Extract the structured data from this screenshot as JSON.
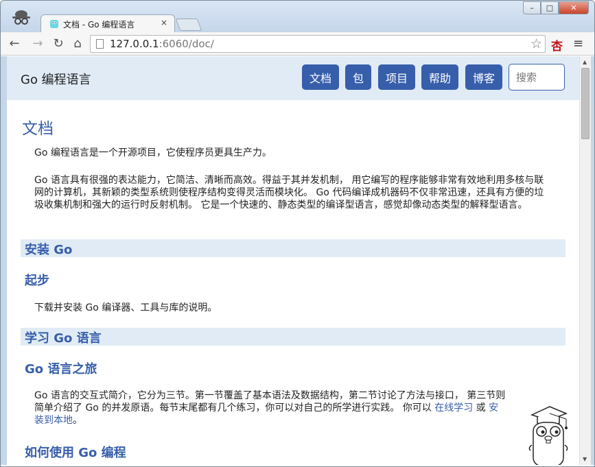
{
  "browser": {
    "tab_title": "文档 - Go 编程语言",
    "tab_close": "×",
    "url_host": "127.0.0.1",
    "url_rest": ":6060/doc/",
    "controls": {
      "min": "–",
      "max": "□",
      "close": "✕"
    },
    "nav": {
      "back": "←",
      "forward": "→",
      "reload": "↻",
      "home": "⌂"
    },
    "star": "☆",
    "ext_icon": "杏",
    "menu": "≡"
  },
  "site": {
    "title": "Go 编程语言",
    "nav": [
      {
        "label": "文档"
      },
      {
        "label": "包"
      },
      {
        "label": "项目"
      },
      {
        "label": "帮助"
      },
      {
        "label": "博客"
      }
    ],
    "search_placeholder": "搜索"
  },
  "page": {
    "heading": "文档",
    "intro1": "Go 编程语言是一个开源项目，它使程序员更具生产力。",
    "intro2": "Go 语言具有很强的表达能力，它简洁、清晰而高效。得益于其并发机制， 用它编写的程序能够非常有效地利用多核与联网的计算机，其新颖的类型系统则使程序结构变得灵活而模块化。 Go 代码编译成机器码不仅非常迅速，还具有方便的垃圾收集机制和强大的运行时反射机制。 它是一个快速的、静态类型的编译型语言，感觉却像动态类型的解释型语言。",
    "sections": {
      "install": {
        "title": "安装 Go",
        "sub": "起步",
        "text": "下载并安装 Go 编译器、工具与库的说明。"
      },
      "learn": {
        "title": "学习 Go 语言",
        "sub": "Go 语言之旅",
        "text_before": "Go 语言的交互式简介，它分为三节。第一节覆盖了基本语法及数据结构，第二节讨论了方法与接口， 第三节则简单介绍了 Go 的并发原语。每节末尾都有几个练习，你可以对自己的所学进行实践。 你可以 ",
        "link1": "在线学习",
        "text_mid": " 或 ",
        "link2": "安装到本地",
        "text_after": "。",
        "next": "如何使用 Go 编程"
      }
    }
  }
}
